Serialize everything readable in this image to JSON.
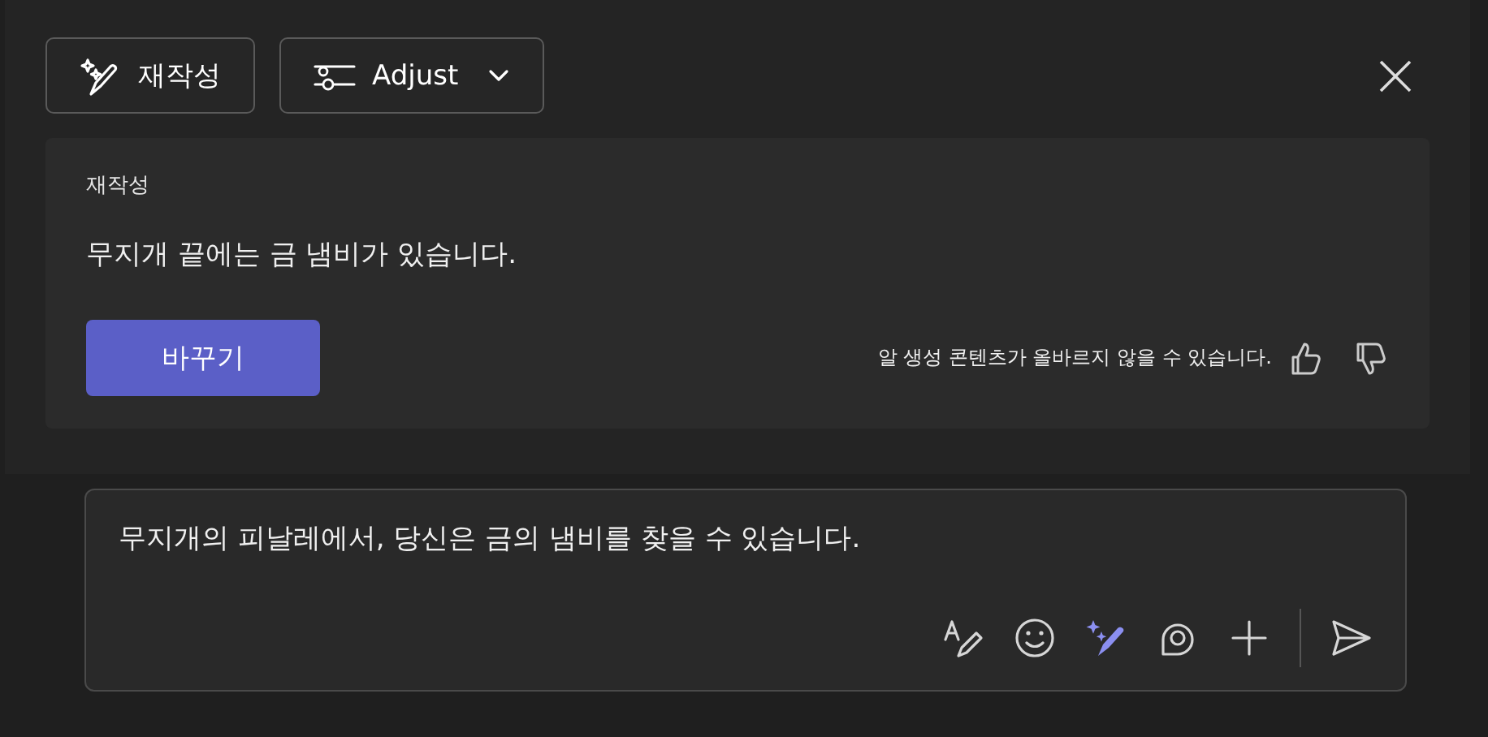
{
  "toolbar": {
    "rewrite_button": {
      "label": "재작성"
    },
    "adjust_button": {
      "label": "Adjust"
    }
  },
  "suggestion": {
    "heading": "재작성",
    "text": "무지개 끝에는 금 냄비가 있습니다.",
    "replace_button": "바꾸기",
    "disclaimer": "알 생성 콘텐츠가 올바르지 않을 수 있습니다."
  },
  "compose": {
    "value": "무지개의 피날레에서, 당신은 금의 냄비를 찾을 수 있습니다.",
    "tools": [
      {
        "kind": "format",
        "active": false
      },
      {
        "kind": "emoji",
        "active": false
      },
      {
        "kind": "rewrite",
        "active": true
      },
      {
        "kind": "loop",
        "active": false
      },
      {
        "kind": "attach",
        "active": false
      }
    ]
  }
}
